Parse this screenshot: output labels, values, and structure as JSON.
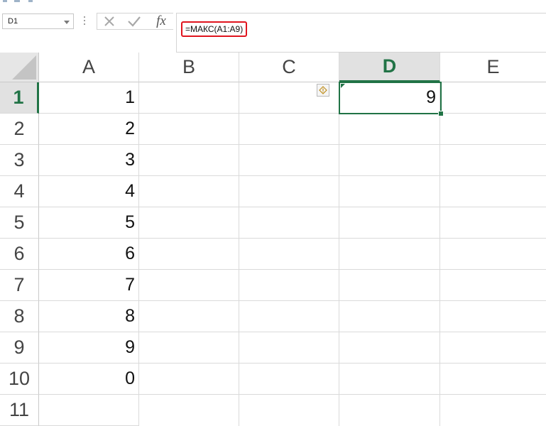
{
  "name_box": {
    "value": "D1"
  },
  "formula_bar": {
    "formula": "=МАКС(A1:A9)",
    "cancel_icon": "cross-icon",
    "enter_icon": "checkmark-icon",
    "fx_label": "fx"
  },
  "columns": [
    "A",
    "B",
    "C",
    "D",
    "E"
  ],
  "rows": [
    "1",
    "2",
    "3",
    "4",
    "5",
    "6",
    "7",
    "8",
    "9",
    "10",
    "11"
  ],
  "active_cell": {
    "column": "D",
    "row": "1"
  },
  "cells": {
    "A": [
      "1",
      "2",
      "3",
      "4",
      "5",
      "6",
      "7",
      "8",
      "9",
      "0",
      ""
    ],
    "D1": "9"
  },
  "colors": {
    "accent": "#217346",
    "highlight": "#e0141e"
  }
}
